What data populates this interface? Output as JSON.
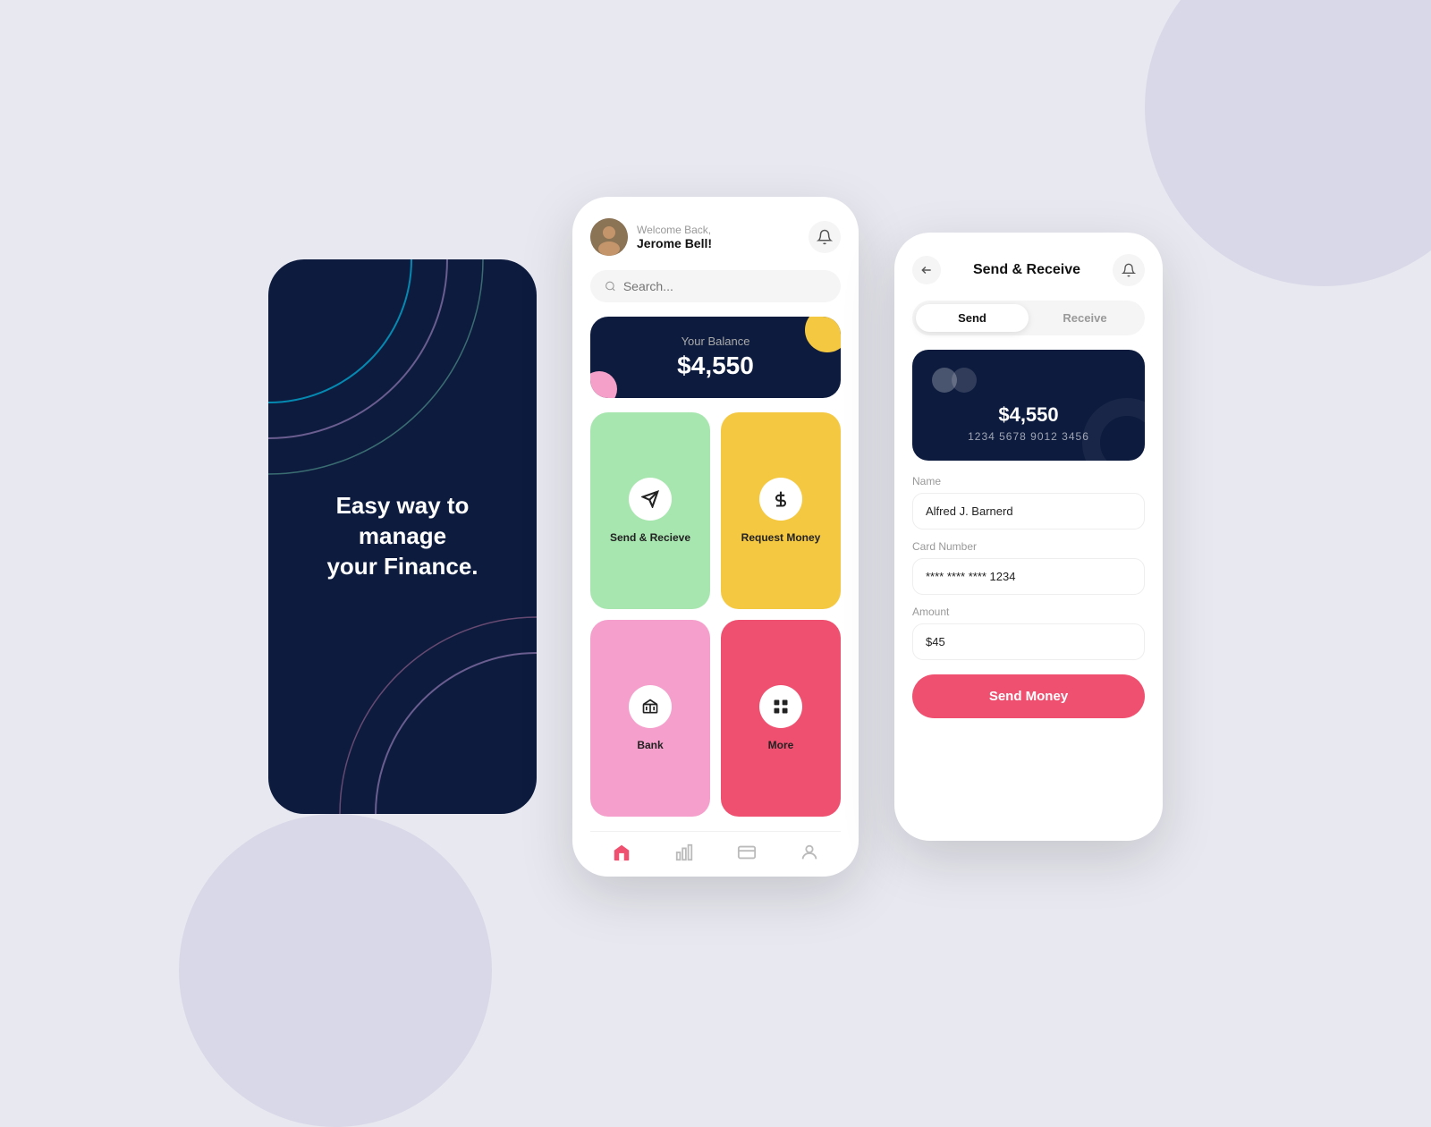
{
  "splash": {
    "bg_color": "#0d1b3e",
    "headline_line1": "Easy way to manage",
    "headline_line2": "your Finance."
  },
  "home": {
    "header": {
      "welcome_sub": "Welcome Back,",
      "welcome_name": "Jerome Bell!",
      "bell_icon": "🔔",
      "avatar_emoji": "👤"
    },
    "search": {
      "placeholder": "Search..."
    },
    "balance": {
      "label": "Your Balance",
      "amount": "$4,550"
    },
    "actions": [
      {
        "id": "send-receive",
        "label": "Send & Recieve",
        "icon": "➤",
        "color_class": "tile-green"
      },
      {
        "id": "request-money",
        "label": "Request Money",
        "icon": "⬇",
        "color_class": "tile-yellow"
      },
      {
        "id": "bank",
        "label": "Bank",
        "icon": "🏦",
        "color_class": "tile-pink"
      },
      {
        "id": "more",
        "label": "More",
        "icon": "⊞",
        "color_class": "tile-red"
      }
    ],
    "nav": [
      {
        "id": "home",
        "icon": "⌂",
        "active": true
      },
      {
        "id": "chart",
        "icon": "📊",
        "active": false
      },
      {
        "id": "card",
        "icon": "🪪",
        "active": false
      },
      {
        "id": "profile",
        "icon": "👤",
        "active": false
      }
    ]
  },
  "send_receive": {
    "title": "Send & Receive",
    "back_icon": "←",
    "bell_icon": "🔔",
    "tabs": [
      {
        "label": "Send",
        "active": true
      },
      {
        "label": "Receive",
        "active": false
      }
    ],
    "card": {
      "balance": "$4,550",
      "number": "1234 5678 9012 3456"
    },
    "form": {
      "name_label": "Name",
      "name_value": "Alfred J. Barnerd",
      "card_label": "Card Number",
      "card_value": "**** **** **** 1234",
      "amount_label": "Amount",
      "amount_value": "$45"
    },
    "send_button": "Send Money"
  }
}
